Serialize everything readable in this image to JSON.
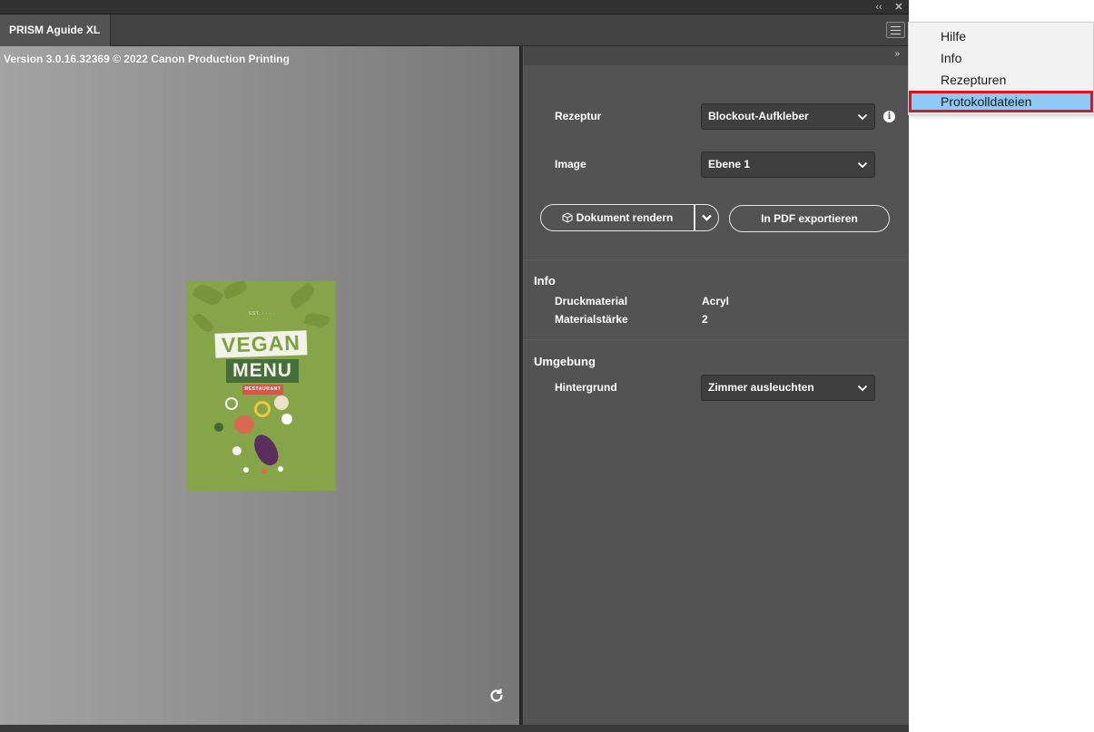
{
  "window": {
    "controls": [
      "‹‹",
      "✕"
    ],
    "tab_title": "PRISM Aguide XL"
  },
  "preview": {
    "version_text": "Version 3.0.16.32369 © 2022 Canon Production Printing",
    "poster": {
      "small_line_1": "EST. · · · ·",
      "small_line_2": "· · · · · ·",
      "title_1": "VEGAN",
      "title_2": "MENU",
      "tag": "RESTAURANT"
    },
    "rotate_icon": "rotate-icon"
  },
  "panel": {
    "fast_forward_icon": "»",
    "rezeptur": {
      "label": "Rezeptur",
      "value": "Blockout-Aufkleber"
    },
    "image": {
      "label": "Image",
      "value": "Ebene 1"
    },
    "buttons": {
      "render": "Dokument rendern",
      "export": "In PDF exportieren"
    },
    "info": {
      "title": "Info",
      "rows": [
        {
          "key": "Druckmaterial",
          "value": "Acryl"
        },
        {
          "key": "Materialstärke",
          "value": "2"
        }
      ]
    },
    "umgebung": {
      "title": "Umgebung",
      "hintergrund": {
        "label": "Hintergrund",
        "value": "Zimmer ausleuchten"
      }
    }
  },
  "flyout_menu": {
    "items": [
      "Hilfe",
      "Info",
      "Rezepturen",
      "Protokolldateien"
    ],
    "selected_index": 3,
    "highlight_color": "#90c8f6",
    "outline_color": "#e0141e"
  },
  "colors": {
    "panel_bg": "#535353",
    "chrome_bg": "#323232",
    "poster_green": "#86a448"
  }
}
